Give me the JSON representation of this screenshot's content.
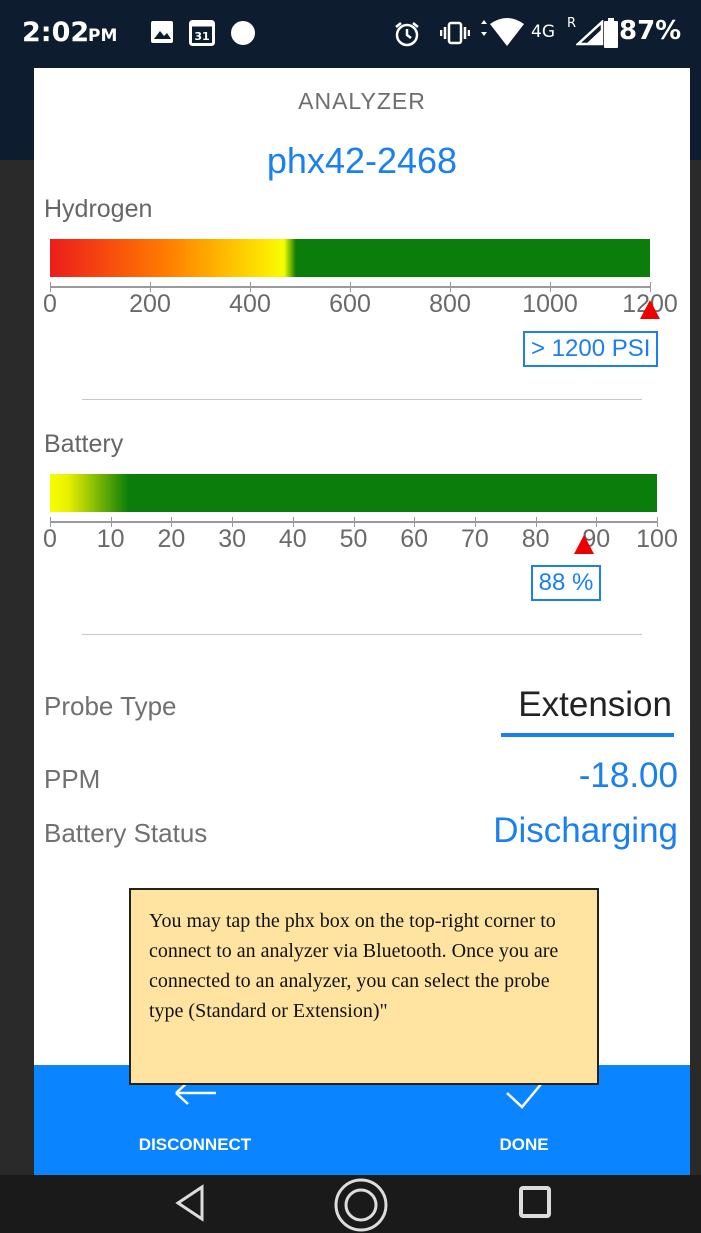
{
  "status_bar": {
    "time": "2:02",
    "ampm": "PM",
    "calendar_day": "31",
    "network": "4G",
    "roaming": "R",
    "battery_percent": "87%",
    "icons": [
      "image-icon",
      "calendar-icon",
      "circle-dot-icon",
      "alarm-icon",
      "vibrate-icon",
      "wifi-icon",
      "signal-icon",
      "battery-icon"
    ]
  },
  "dialog": {
    "title": "ANALYZER",
    "device_id": "phx42-2468"
  },
  "hydrogen": {
    "label": "Hydrogen",
    "ticks": [
      "0",
      "200",
      "400",
      "600",
      "800",
      "1000",
      "1200"
    ],
    "reading_label": "> 1200 PSI",
    "level_fraction": 1.0
  },
  "battery": {
    "label": "Battery",
    "ticks": [
      "0",
      "10",
      "20",
      "30",
      "40",
      "50",
      "60",
      "70",
      "80",
      "90",
      "100"
    ],
    "reading_label": "88 %",
    "level_fraction": 0.88
  },
  "details": {
    "probe_type_label": "Probe Type",
    "probe_type_value": "Extension",
    "ppm_label": "PPM",
    "ppm_value": "-18.00",
    "battery_status_label": "Battery Status",
    "battery_status_value": "Discharging"
  },
  "tooltip": {
    "text": "You may tap the phx box on the top-right corner to connect to an analyzer via Bluetooth. Once you are connected to an analyzer, you can select the probe type (Standard or Extension)\""
  },
  "actions": {
    "disconnect_label": "DISCONNECT",
    "done_label": "DONE"
  },
  "colors": {
    "accent": "#0a84ff",
    "link_blue": "#1a7ff0",
    "marker_red": "#ee0000",
    "bar_green": "#0a7d0a",
    "tooltip_bg": "#ffe3a0"
  }
}
